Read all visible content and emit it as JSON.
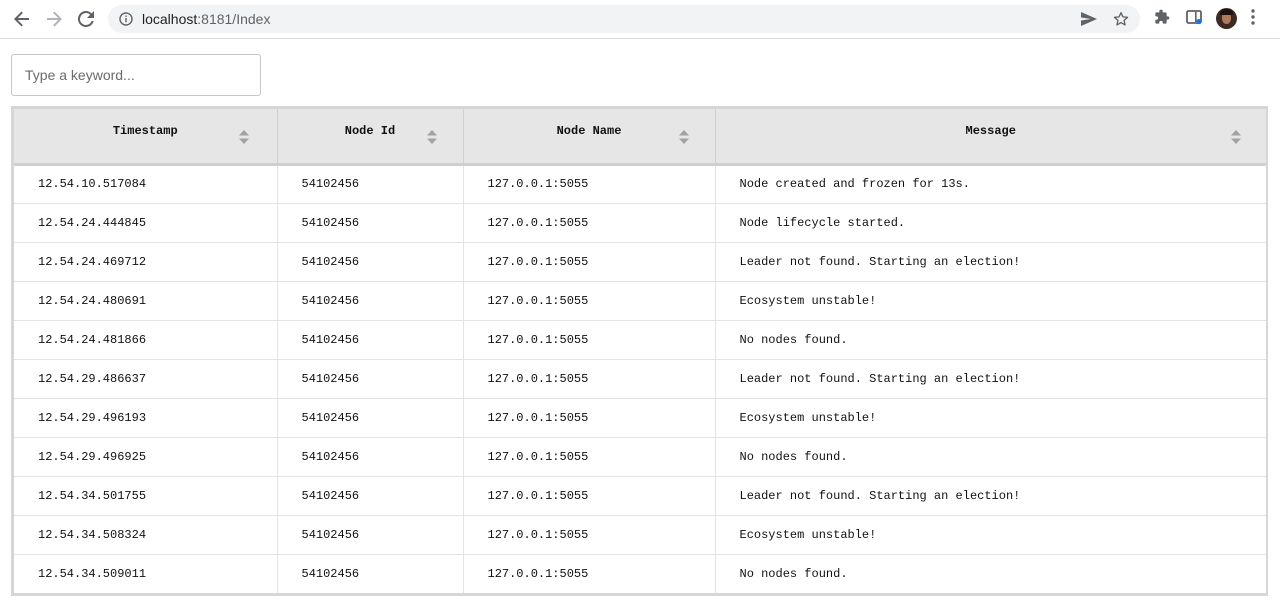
{
  "browser": {
    "url_host": "localhost",
    "url_rest": ":8181/Index"
  },
  "search": {
    "placeholder": "Type a keyword..."
  },
  "table": {
    "columns": [
      "Timestamp",
      "Node Id",
      "Node Name",
      "Message"
    ],
    "rows": [
      [
        "12.54.10.517084",
        "54102456",
        "127.0.0.1:5055",
        "Node created and frozen for 13s."
      ],
      [
        "12.54.24.444845",
        "54102456",
        "127.0.0.1:5055",
        "Node lifecycle started."
      ],
      [
        "12.54.24.469712",
        "54102456",
        "127.0.0.1:5055",
        "Leader not found. Starting an election!"
      ],
      [
        "12.54.24.480691",
        "54102456",
        "127.0.0.1:5055",
        "Ecosystem unstable!"
      ],
      [
        "12.54.24.481866",
        "54102456",
        "127.0.0.1:5055",
        "No nodes found."
      ],
      [
        "12.54.29.486637",
        "54102456",
        "127.0.0.1:5055",
        "Leader not found. Starting an election!"
      ],
      [
        "12.54.29.496193",
        "54102456",
        "127.0.0.1:5055",
        "Ecosystem unstable!"
      ],
      [
        "12.54.29.496925",
        "54102456",
        "127.0.0.1:5055",
        "No nodes found."
      ],
      [
        "12.54.34.501755",
        "54102456",
        "127.0.0.1:5055",
        "Leader not found. Starting an election!"
      ],
      [
        "12.54.34.508324",
        "54102456",
        "127.0.0.1:5055",
        "Ecosystem unstable!"
      ],
      [
        "12.54.34.509011",
        "54102456",
        "127.0.0.1:5055",
        "No nodes found."
      ]
    ]
  }
}
